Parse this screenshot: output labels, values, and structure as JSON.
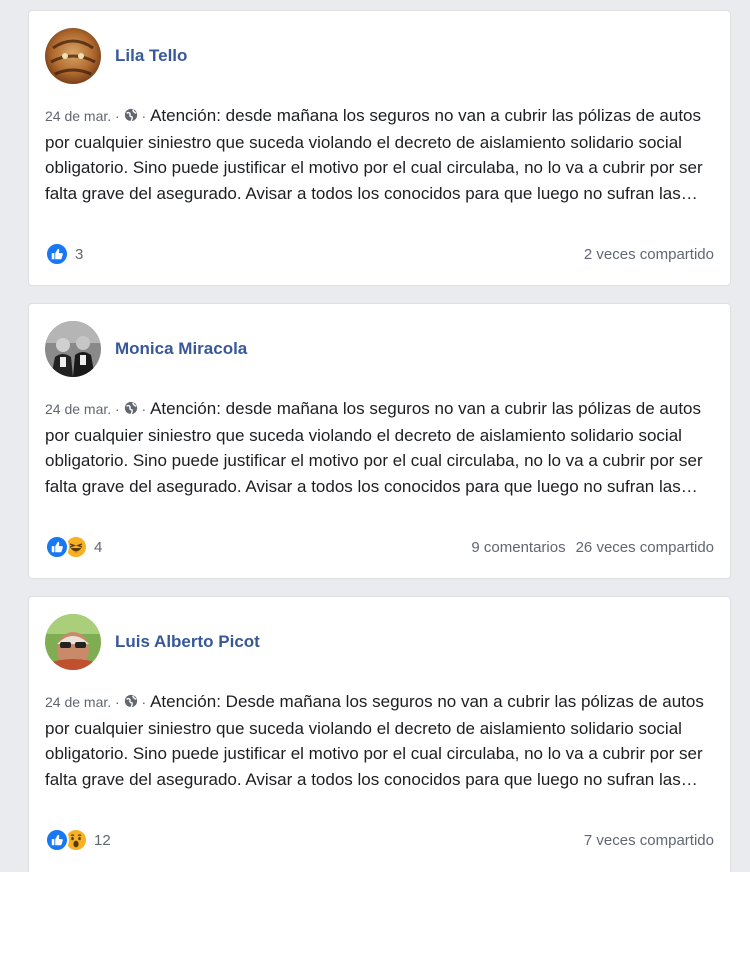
{
  "posts": [
    {
      "author": "Lila Tello",
      "date": "24 de mar.",
      "text": "Atención: desde mañana los seguros no van a cubrir las pólizas de autos por cualquier siniestro que suceda violando el decreto de aislamiento solidario social obligatorio. Sino puede justificar el motivo por el cual circulaba, no lo va a cubrir por ser falta grave del asegurado. Avisar a todos los conocidos para que luego no sufran las…",
      "reactions": [
        "like"
      ],
      "reaction_count": "3",
      "comments": "",
      "shares": "2 veces compartido"
    },
    {
      "author": "Monica Miracola",
      "date": "24 de mar.",
      "text": "Atención: desde mañana los seguros no van a cubrir las pólizas de autos por cualquier siniestro que suceda violando el decreto de aislamiento solidario social obligatorio. Sino puede justificar el motivo por el cual circulaba, no lo va a cubrir por ser falta grave del asegurado. Avisar a todos los conocidos para que luego no sufran las…",
      "reactions": [
        "like",
        "haha"
      ],
      "reaction_count": "4",
      "comments": "9 comentarios",
      "shares": "26 veces compartido"
    },
    {
      "author": "Luis Alberto Picot",
      "date": "24 de mar.",
      "text": "Atención: Desde mañana los seguros no van a cubrir las pólizas de autos por cualquier siniestro que suceda violando el decreto de aislamiento solidario social obligatorio. Sino puede justificar el motivo por el cual circulaba, no lo va a cubrir por ser falta grave del asegurado. Avisar a todos los conocidos para que luego no sufran las…",
      "reactions": [
        "like",
        "wow"
      ],
      "reaction_count": "12",
      "comments": "",
      "shares": "7 veces compartido"
    }
  ],
  "colors": {
    "author_link": "#385898",
    "like_blue": "#1877f2",
    "emoji_yellow": "#f7b125",
    "feed_background": "#e9ebee"
  }
}
